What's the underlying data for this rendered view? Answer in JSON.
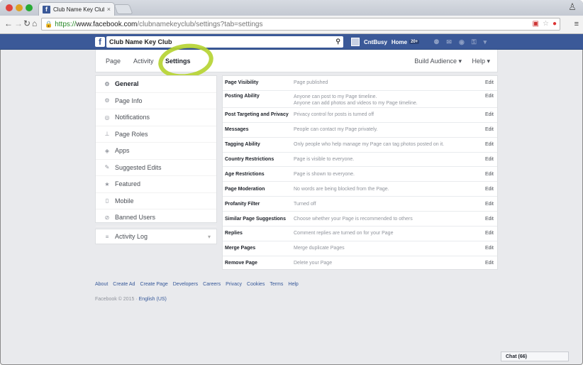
{
  "browser": {
    "tab_title": "Club Name Key Club",
    "tab_close": "×",
    "url_https": "https://",
    "url_host": "www.facebook.com",
    "url_path": "/clubnamekeyclub/settings?tab=settings"
  },
  "fb_header": {
    "search_value": "Club Name Key Club",
    "user_name": "CntBusy",
    "home_label": "Home",
    "home_badge": "20+"
  },
  "page_nav": {
    "page": "Page",
    "activity": "Activity",
    "settings": "Settings",
    "build_audience": "Build Audience ▾",
    "help": "Help ▾"
  },
  "left_menu": [
    {
      "label": "General",
      "icon": "gear-icon",
      "glyph": "⚙",
      "active": true
    },
    {
      "label": "Page Info",
      "icon": "gear-small-icon",
      "glyph": "⚙",
      "active": false
    },
    {
      "label": "Notifications",
      "icon": "globe-icon",
      "glyph": "◎",
      "active": false
    },
    {
      "label": "Page Roles",
      "icon": "person-icon",
      "glyph": "⊥",
      "active": false
    },
    {
      "label": "Apps",
      "icon": "apps-icon",
      "glyph": "◈",
      "active": false
    },
    {
      "label": "Suggested Edits",
      "icon": "edit-icon",
      "glyph": "✎",
      "active": false
    },
    {
      "label": "Featured",
      "icon": "star-icon",
      "glyph": "★",
      "active": false
    },
    {
      "label": "Mobile",
      "icon": "mobile-icon",
      "glyph": "▯",
      "active": false
    },
    {
      "label": "Banned Users",
      "icon": "banned-icon",
      "glyph": "⊘",
      "active": false
    }
  ],
  "activity_log": {
    "label": "Activity Log",
    "icon": "list-icon",
    "glyph": "≡",
    "chevron": "▾"
  },
  "settings_rows": [
    {
      "label": "Page Visibility",
      "value": "Page published",
      "edit": "Edit"
    },
    {
      "label": "Posting Ability",
      "value": "Anyone can post to my Page timeline.",
      "value2": "Anyone can add photos and videos to my Page timeline.",
      "edit": "Edit"
    },
    {
      "label": "Post Targeting and Privacy",
      "value": "Privacy control for posts is turned off",
      "edit": "Edit"
    },
    {
      "label": "Messages",
      "value": "People can contact my Page privately.",
      "edit": "Edit"
    },
    {
      "label": "Tagging Ability",
      "value": "Only people who help manage my Page can tag photos posted on it.",
      "edit": "Edit"
    },
    {
      "label": "Country Restrictions",
      "value": "Page is visible to everyone.",
      "edit": "Edit"
    },
    {
      "label": "Age Restrictions",
      "value": "Page is shown to everyone.",
      "edit": "Edit"
    },
    {
      "label": "Page Moderation",
      "value": "No words are being blocked from the Page.",
      "edit": "Edit"
    },
    {
      "label": "Profanity Filter",
      "value": "Turned off",
      "edit": "Edit"
    },
    {
      "label": "Similar Page Suggestions",
      "value": "Choose whether your Page is recommended to others",
      "edit": "Edit"
    },
    {
      "label": "Replies",
      "value": "Comment replies are turned on for your Page",
      "edit": "Edit"
    },
    {
      "label": "Merge Pages",
      "value": "Merge duplicate Pages",
      "edit": "Edit"
    },
    {
      "label": "Remove Page",
      "value": "Delete your Page",
      "edit": "Edit"
    }
  ],
  "footer": {
    "links": [
      "About",
      "Create Ad",
      "Create Page",
      "Developers",
      "Careers",
      "Privacy",
      "Cookies",
      "Terms",
      "Help"
    ],
    "copyright": "Facebook © 2015 · ",
    "language": "English (US)"
  },
  "chat": {
    "label": "Chat (66)"
  },
  "colors": {
    "facebook_blue": "#3b5998",
    "highlight_green": "#b6d433",
    "link_blue": "#365899"
  }
}
